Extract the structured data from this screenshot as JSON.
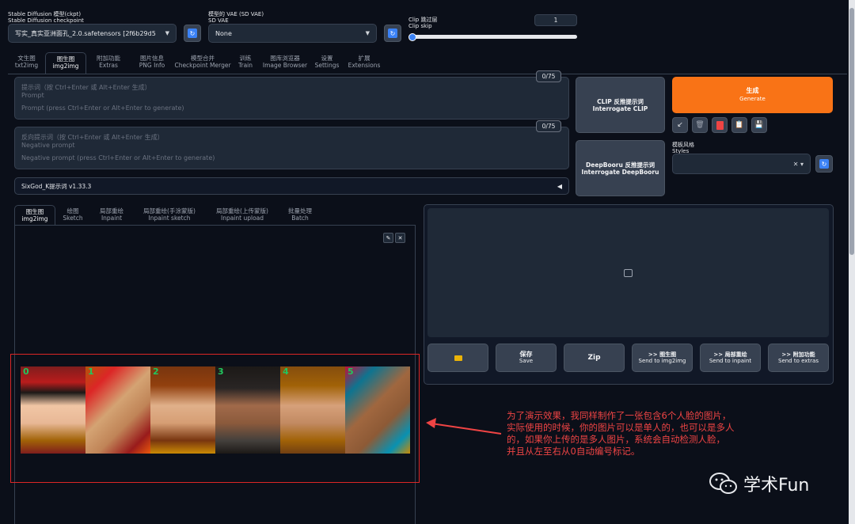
{
  "top": {
    "checkpoint_label_cn": "Stable Diffusion 模型(ckpt)",
    "checkpoint_label_en": "Stable Diffusion checkpoint",
    "checkpoint_value": "写实_真实亚洲面孔_2.0.safetensors [2f6b29d5",
    "vae_label_cn": "模型的 VAE (SD VAE)",
    "vae_label_en": "SD VAE",
    "vae_value": "None",
    "clip_label_cn": "Clip 跳过层",
    "clip_label_en": "Clip skip",
    "clip_value": "1",
    "clip_slider_fraction": 0.0
  },
  "main_tabs": [
    {
      "cn": "文生图",
      "en": "txt2img"
    },
    {
      "cn": "图生图",
      "en": "img2img"
    },
    {
      "cn": "附加功能",
      "en": "Extras"
    },
    {
      "cn": "图片信息",
      "en": "PNG Info"
    },
    {
      "cn": "模型合并",
      "en": "Checkpoint Merger"
    },
    {
      "cn": "训练",
      "en": "Train"
    },
    {
      "cn": "图库浏览器",
      "en": "Image Browser"
    },
    {
      "cn": "设置",
      "en": "Settings"
    },
    {
      "cn": "扩展",
      "en": "Extensions"
    }
  ],
  "prompt": {
    "placeholder_cn": "提示词（按 Ctrl+Enter 或 Alt+Enter 生成）",
    "placeholder_en": "Prompt",
    "hint": "Prompt (press Ctrl+Enter or Alt+Enter to generate)",
    "counter": "0/75"
  },
  "negative": {
    "placeholder_cn": "反向提示词（按 Ctrl+Enter 或 Alt+Enter 生成）",
    "placeholder_en": "Negative prompt",
    "hint": "Negative prompt (press Ctrl+Enter or Alt+Enter to generate)",
    "counter": "0/75"
  },
  "interrogate_clip": {
    "cn": "CLIP  反推提示词",
    "en": "Interrogate CLIP"
  },
  "interrogate_deepbooru": {
    "cn": "DeepBooru 反推提示词",
    "en": "Interrogate DeepBooru"
  },
  "generate": {
    "cn": "生成",
    "en": "Generate"
  },
  "styles": {
    "cn": "模板风格",
    "en": "Styles"
  },
  "tool_icons": [
    "arrow-icon",
    "trash-icon",
    "red-card-icon",
    "clipboard-icon",
    "save-style-icon"
  ],
  "sixgod": {
    "label": "SixGod_K提示词 v1.33.3",
    "toggle": "◀"
  },
  "sub_tabs": [
    {
      "cn": "图生图",
      "en": "img2img"
    },
    {
      "cn": "绘图",
      "en": "Sketch"
    },
    {
      "cn": "局部重绘",
      "en": "Inpaint"
    },
    {
      "cn": "局部重绘(手涂蒙版)",
      "en": "Inpaint sketch"
    },
    {
      "cn": "局部重绘(上传蒙版)",
      "en": "Inpaint upload"
    },
    {
      "cn": "批量处理",
      "en": "Batch"
    }
  ],
  "face_labels": [
    "0",
    "1",
    "2",
    "3",
    "4",
    "5"
  ],
  "output_buttons": [
    {
      "cn": "",
      "en": "",
      "icon": "folder-icon"
    },
    {
      "cn": "保存",
      "en": "Save"
    },
    {
      "cn": "Zip",
      "en": ""
    },
    {
      "cn": ">> 图生图",
      "en": "Send to img2img"
    },
    {
      "cn": ">> 局部重绘",
      "en": "Send to inpaint"
    },
    {
      "cn": ">> 附加功能",
      "en": "Send to extras"
    }
  ],
  "annotation": {
    "line1": "为了演示效果，我同样制作了一张包含6个人脸的图片，",
    "line2": "实际使用的时候，你的图片可以是单人的，也可以是多人",
    "line3": "的，如果你上传的是多人图片，系统会自动检测人脸，",
    "line4": "并且从左至右从0自动编号标记。"
  },
  "watermark": "学术Fun",
  "colors": {
    "accent": "#f97316",
    "annotation": "#ef4444",
    "face_number": "#22c55e",
    "refresh": "#3b82f6"
  }
}
